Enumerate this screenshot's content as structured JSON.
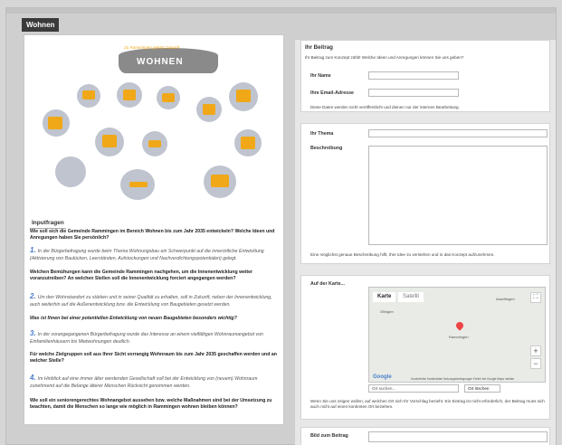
{
  "section_tag": "Wohnen",
  "poster": {
    "title": "WOHNEN",
    "subtitle": "Zu Rammingen gehört Zukunft"
  },
  "inputfragen": {
    "heading": "Inputfragen",
    "intro_q": "Wie soll sich die Gemeinde Rammingen im Bereich Wohnen bis zum Jahr 2035 entwickeln? Welche Ideen und Anregungen haben Sie persönlich?",
    "p1_num": "1.",
    "p1": "In der Bürgerbefragung wurde beim Thema Wohnungsbau ein Schwerpunkt auf die innerörtliche Entwicklung (Aktivierung von Baulücken, Leerständen, Aufstockungen und Nachverdichtungspotentialen) gelegt.",
    "q1": "Welchen Bemühungen kann die Gemeinde Rammingen nachgehen, um die Innenentwicklung weiter voranzutreiben? An welchen Stellen soll die Innenentwicklung forciert angegangen werden?",
    "p2_num": "2.",
    "p2": "Um den Wohnstandort zu stärken und in seiner Qualität zu erhalten, soll in Zukunft, neben der Innenentwicklung, auch weiterhin auf die Außenentwicklung bzw. die Entwicklung von Baugebieten gesetzt werden.",
    "q2": "Was ist Ihnen bei einer potentiellen Entwicklung von neuen Baugebieten besonders wichtig?",
    "p3_num": "3.",
    "p3": "In der vorangegangenen Bürgerbefragung wurde das Interesse an einem vielfältigen Wohnraumangebot von Einfamilienhäusern bis Mietwohnungen deutlich.",
    "q3": "Für welche Zielgruppen soll aus Ihrer Sicht vorrangig Wohnraum bis zum Jahr 2035 geschaffen werden und an welcher Stelle?",
    "p4_num": "4.",
    "p4": "Im Hinblick auf eine immer älter werdenden Gesellschaft soll bei der Entwicklung von (neuem) Wohnraum zunehmend auf die Belange älterer Menschen Rücksicht genommen werden.",
    "q4": "Wie soll ein seniorengerechtes Wohnangebot aussehen bzw. welche Maßnahmen sind bei der Umsetzung zu beachten, damit die Menschen so lange wie möglich in Rammingen wohnen bleiben können?"
  },
  "form": {
    "heading": "Ihr Beitrag",
    "subheading": "Ihr Beitrag zum Konzept zählt! Welche Ideen und Anregungen können Sie uns geben?",
    "name_label": "Ihr Name",
    "email_label": "Ihre Email-Adresse",
    "privacy_note": "Diese Daten werden nicht veröffentlicht und dienen nur der internen Bearbeitung.",
    "topic_label": "Ihr Thema",
    "desc_label": "Beschreibung",
    "desc_note": "Eine möglichst genaue Beschreibung hilft, Ihre Idee zu verstehen und in das Konzept aufzunehmen.",
    "map_label": "Auf der Karte...",
    "map_tab_map": "Karte",
    "map_tab_sat": "Satellit",
    "map_place_main": "Rammingen",
    "map_place_ne": "Asselfingen",
    "map_place_w": "Öllingen",
    "map_footer": "Kurzbefehle   Kartendaten   Nutzungsbedingungen   Fehler bei Google Maps melden",
    "map_search_placeholder": "Ort suchen...",
    "map_clear_button": "Ort löschen",
    "map_note": "Wenn Sie uns zeigen wollen, auf welchen Ort sich Ihr Vorschlag bezieht. Ein Eintrag ist nicht erforderlich, der Beitrag muss sich auch nicht auf einen konkreten Ort beziehen.",
    "image_label": "Bild zum Beitrag"
  }
}
